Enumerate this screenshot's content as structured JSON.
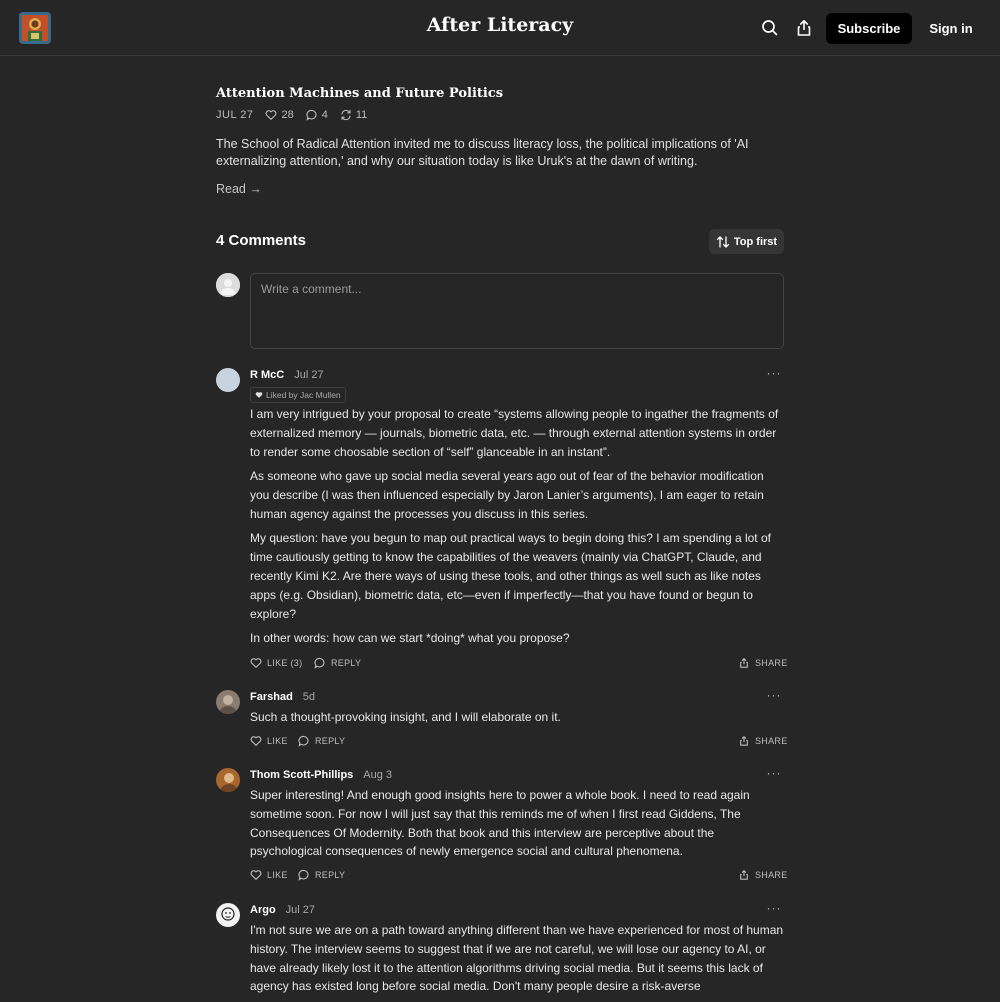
{
  "header": {
    "site_title": "After Literacy",
    "subscribe_label": "Subscribe",
    "signin_label": "Sign in",
    "icons": [
      "search-icon",
      "share-icon"
    ]
  },
  "post": {
    "title": "Attention Machines and Future Politics",
    "date": "JUL 27",
    "likes": "28",
    "comments": "4",
    "restacks": "11",
    "description": "The School of Radical Attention invited me to discuss literacy loss, the political implications of 'AI externalizing attention,' and why our situation today is like Uruk's at the dawn of writing.",
    "read_label": "Read →"
  },
  "comments_section": {
    "title": "4 Comments",
    "sort_label": "Top first",
    "input_placeholder": "Write a comment..."
  },
  "comments": [
    {
      "author": "R McC",
      "date": "Jul 27",
      "liked_by": "Liked by Jac Mullen",
      "paragraphs": [
        "I am very intrigued by your proposal to create “systems allowing people to ingather the fragments of externalized memory — journals, biometric data, etc. — through external attention systems in order to render some choosable section of “self” glanceable in an instant”.",
        "As someone who gave up social media several years ago out of fear of the behavior modification you describe (I was then influenced especially by Jaron Lanier’s arguments), I am eager to retain human agency against the processes you discuss in this series.",
        "My question: have you begun to map out practical ways to begin doing this? I am spending a lot of time cautiously getting to know the capabilities of the weavers (mainly via ChatGPT, Claude, and recently Kimi K2. Are there ways of using these tools, and other things as well such as like notes apps (e.g. Obsidian), biometric data, etc—even if imperfectly—that you have found or begun to explore?",
        "In other words: how can we start *doing* what you propose?"
      ],
      "like_label": "LIKE (3)",
      "reply_label": "REPLY",
      "share_label": "SHARE"
    },
    {
      "author": "Farshad",
      "date": "5d",
      "paragraphs": [
        "Such a thought-provoking insight, and I will elaborate on it."
      ],
      "like_label": "LIKE",
      "reply_label": "REPLY",
      "share_label": "SHARE"
    },
    {
      "author": "Thom Scott-Phillips",
      "date": "Aug 3",
      "paragraphs": [
        "Super interesting! And enough good insights here to power a whole book. I need to read again sometime soon. For now I will just say that this reminds me of when I first read Giddens, The Consequences Of Modernity. Both that book and this interview are perceptive about the psychological consequences of newly emergence social and cultural phenomena."
      ],
      "like_label": "LIKE",
      "reply_label": "REPLY",
      "share_label": "SHARE"
    },
    {
      "author": "Argo",
      "date": "Jul 27",
      "paragraphs": [
        "I'm not sure we are on a path toward anything different than we have experienced for most of human history. The interview seems to suggest that if we are not careful, we will lose our agency to AI, or have already likely lost it to the attention algorithms driving social media. But it seems this lack of agency has existed long before social media. Don't many people desire a risk-averse"
      ]
    }
  ]
}
